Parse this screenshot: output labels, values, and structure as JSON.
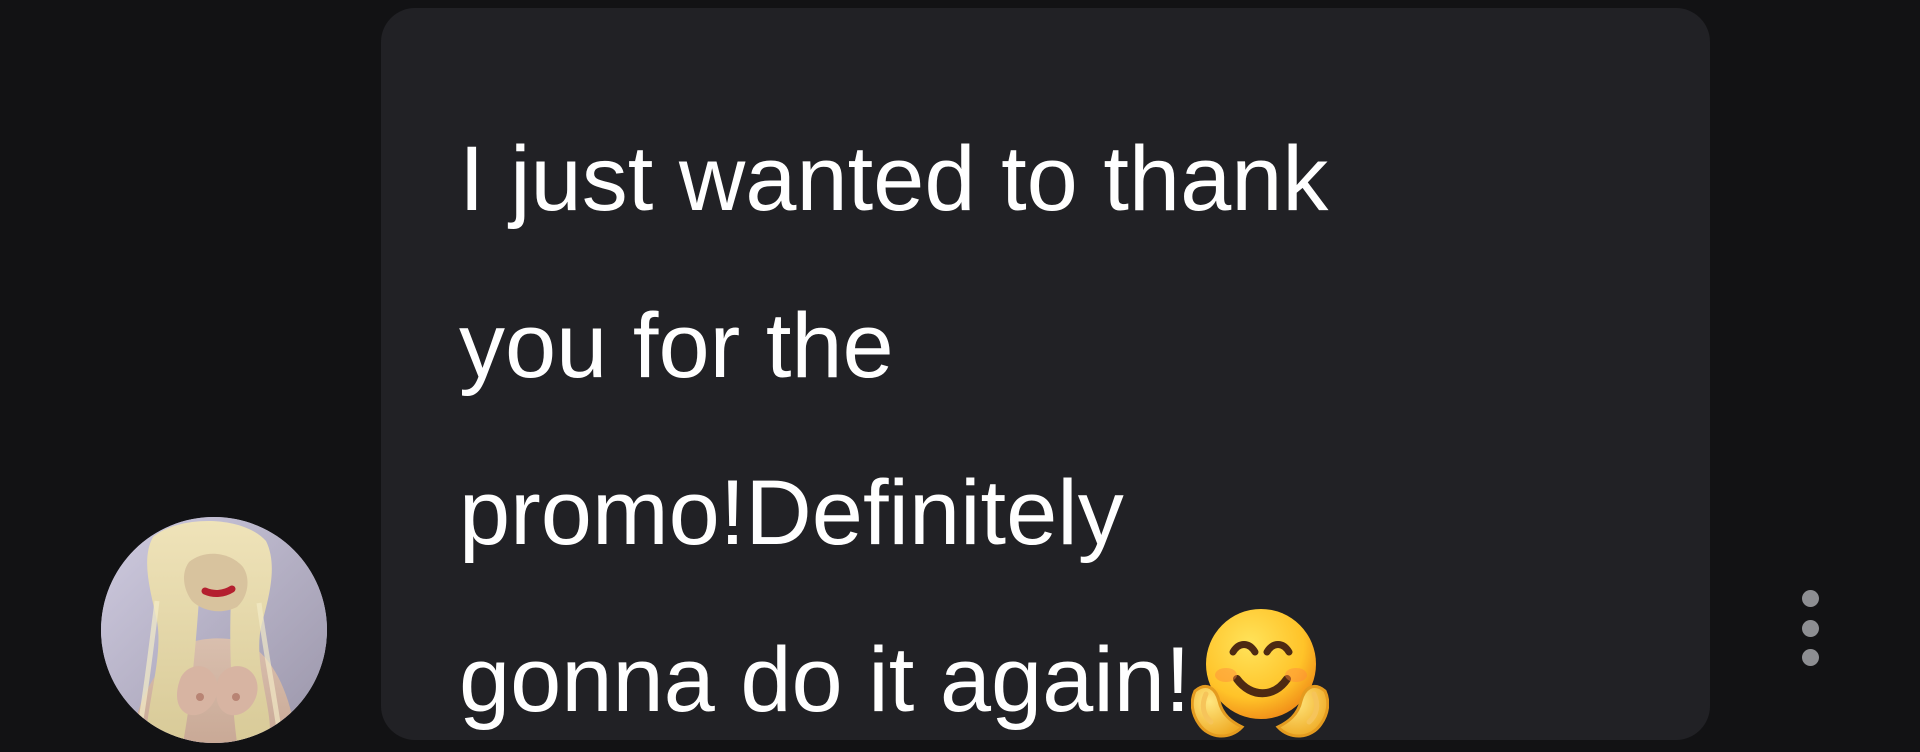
{
  "chat": {
    "message": {
      "lines": [
        "I just wanted to thank",
        "you for the",
        "promo!Definitely",
        "gonna do it again!"
      ],
      "emoji": "hugging-face",
      "bubble_color": "#212125",
      "text_color": "#ffffff"
    },
    "avatar": {
      "type": "profile-photo"
    },
    "more_options_icon": "more-vertical-icon"
  },
  "colors": {
    "background": "#121214",
    "dots": "#8d8e92"
  }
}
